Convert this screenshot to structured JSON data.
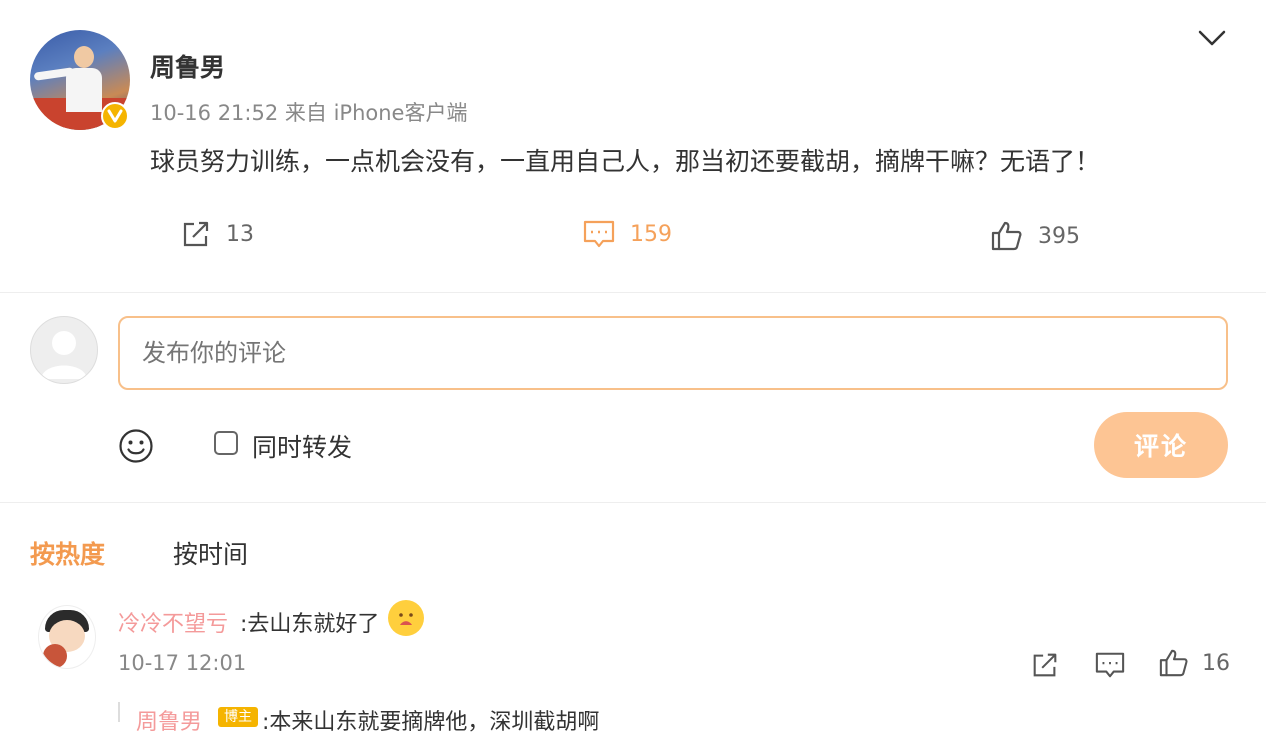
{
  "post": {
    "author": "周鲁男",
    "meta": "10-16 21:52 来自 iPhone客户端",
    "text": "球员努力训练，一点机会没有，一直用自己人，那当初还要截胡，摘牌干嘛？无语了！",
    "actions": {
      "repost_count": "13",
      "comment_count": "159",
      "like_count": "395"
    }
  },
  "composer": {
    "placeholder": "发布你的评论",
    "also_repost_label": "同时转发",
    "also_repost_checked": false,
    "submit_label": "评论"
  },
  "sort": {
    "hot_label": "按热度",
    "time_label": "按时间",
    "active": "hot"
  },
  "comments": [
    {
      "user": "冷冷不望亏",
      "text": ":去山东就好了",
      "time": "10-17 12:01",
      "like_count": "16",
      "reply": {
        "user": "周鲁男",
        "badge": "博主",
        "text": ":本来山东就要摘牌他，深圳截胡啊"
      }
    }
  ],
  "colors": {
    "accent": "#f39a4f",
    "input_border": "#f8c08a",
    "submit_bg": "#fdc594",
    "username": "#f49a9a",
    "vip_badge": "#f5b400"
  },
  "icons": {
    "collapse": "chevron-down-icon",
    "repost": "repost-icon",
    "comment": "comment-icon",
    "like": "like-icon",
    "emoji": "smiley-icon"
  }
}
